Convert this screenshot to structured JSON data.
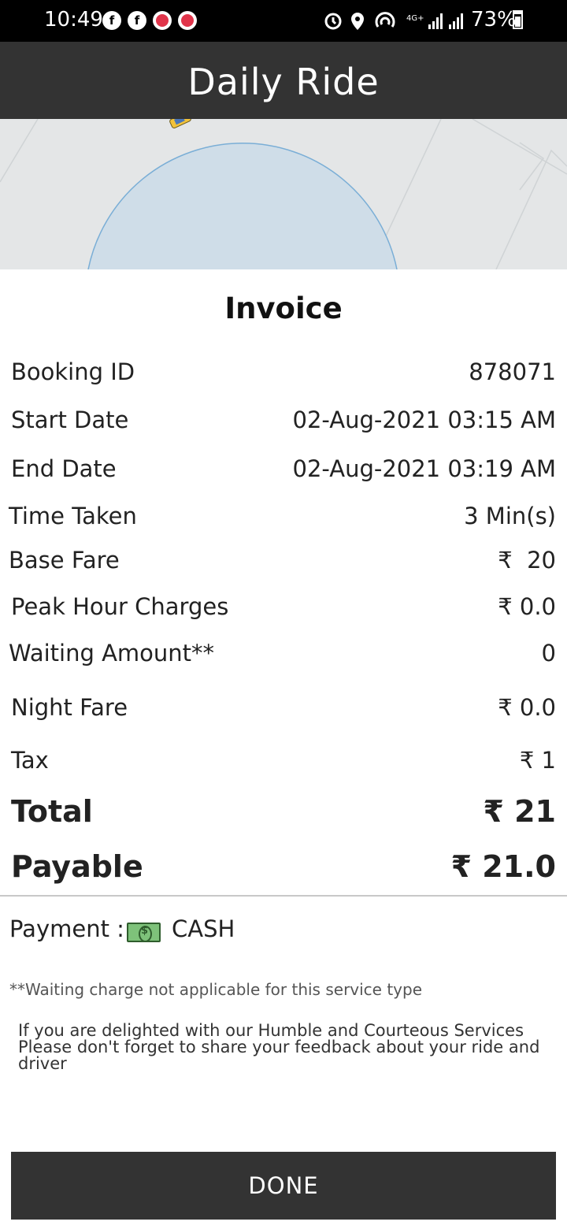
{
  "status_bar": {
    "time": "10:49",
    "battery": "73%",
    "indicators": [
      "alarm-icon",
      "location-icon",
      "hotspot-icon",
      "4g-icon",
      "signal-icon",
      "signal-icon"
    ]
  },
  "app_bar": {
    "title": "Daily Ride"
  },
  "invoice": {
    "title": "Invoice",
    "rows": [
      {
        "label": "Booking ID",
        "value": "878071"
      },
      {
        "label": "Start Date",
        "value": "02-Aug-2021 03:15 AM"
      },
      {
        "label": "End Date",
        "value": "02-Aug-2021 03:19 AM"
      },
      {
        "label": "Time Taken",
        "value": "3 Min(s)"
      },
      {
        "label": "Base Fare",
        "value": "₹  20"
      },
      {
        "label": "Peak Hour Charges",
        "value": "₹ 0.0"
      },
      {
        "label": "Waiting Amount**",
        "value": "0"
      },
      {
        "label": "Night Fare",
        "value": "₹ 0.0"
      },
      {
        "label": "Tax",
        "value": "₹ 1"
      }
    ],
    "total": {
      "label": "Total",
      "value": "₹ 21"
    },
    "payable": {
      "label": "Payable",
      "value": "₹ 21.0"
    }
  },
  "payment": {
    "label": "Payment :",
    "method": "CASH",
    "icon": "cash-icon"
  },
  "waiting_note": "**Waiting charge not applicable for this service type",
  "feedback": {
    "line1": "If you are delighted with our Humble and Courteous Services",
    "line2": "Please don't forget to share your feedback about your ride and",
    "line3": "driver"
  },
  "done_label": "DONE",
  "colors": {
    "app_bar": "#333333",
    "status_bar": "#000000",
    "map_bg": "#e4e6e7",
    "map_circle": "#cfdde8"
  }
}
